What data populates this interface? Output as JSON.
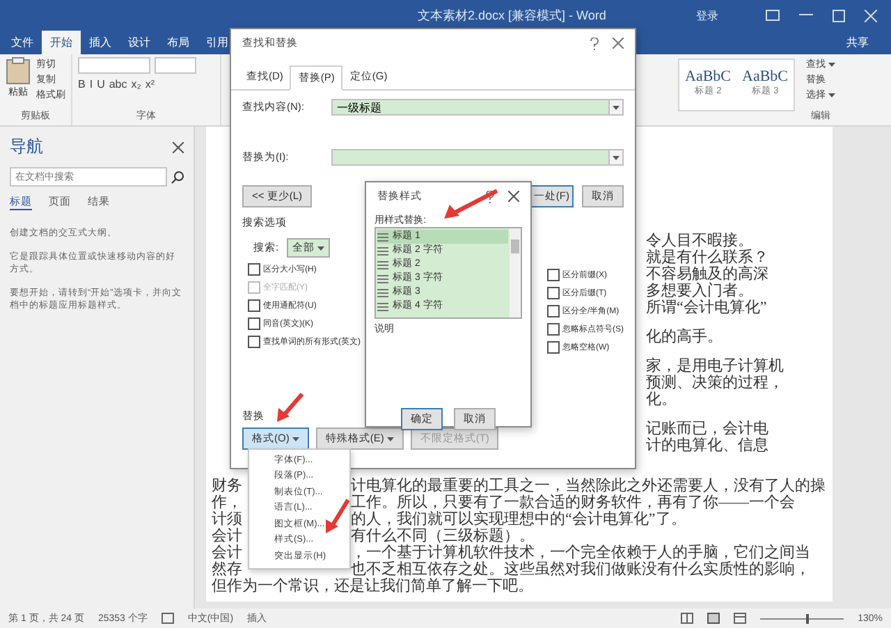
{
  "window": {
    "title": "文本素材2.docx [兼容模式] - Word",
    "account": "登录"
  },
  "ribbon_tabs": [
    {
      "label": "文件",
      "selected": false
    },
    {
      "label": "开始",
      "selected": true
    },
    {
      "label": "插入",
      "selected": false
    },
    {
      "label": "设计",
      "selected": false
    },
    {
      "label": "布局",
      "selected": false
    },
    {
      "label": "引用",
      "selected": false
    }
  ],
  "share_button": "共享",
  "clipboard": {
    "paste": "粘贴",
    "cut": "剪切",
    "copy": "复制",
    "format_painter": "格式刷",
    "label": "剪贴板"
  },
  "font_group": {
    "buttons": [
      "B",
      "I",
      "U",
      "abc",
      "x₂",
      "x²"
    ],
    "label": "字体"
  },
  "styles": [
    {
      "preview": "AaBbC",
      "name": "标题 2"
    },
    {
      "preview": "AaBbC",
      "name": "标题 3"
    }
  ],
  "editing": {
    "items": [
      {
        "label": "查找",
        "has_menu": true
      },
      {
        "label": "替换",
        "has_menu": false
      },
      {
        "label": "选择",
        "has_menu": true
      }
    ],
    "label": "编辑"
  },
  "nav": {
    "title": "导航",
    "search_placeholder": "在文档中搜索",
    "tabs": [
      {
        "label": "标题",
        "selected": true
      },
      {
        "label": "页面",
        "selected": false
      },
      {
        "label": "结果",
        "selected": false
      }
    ],
    "paragraphs": [
      "创建文档的交互式大纲。",
      "它是跟踪具体位置或快速移动内容的好方式。",
      "要想开始，请转到“开始”选项卡，并向文档中的标题应用标题样式。"
    ]
  },
  "find_dialog": {
    "title": "查找和替换",
    "tabs": [
      {
        "label": "查找(D)",
        "selected": false
      },
      {
        "label": "替换(P)",
        "selected": true
      },
      {
        "label": "定位(G)",
        "selected": false
      }
    ],
    "find_label": "查找内容(N):",
    "find_value": "一级标题",
    "replace_label": "替换为(I):",
    "less_button": "<< 更少(L)",
    "next_button": "一处(F)",
    "cancel_button": "取消",
    "options_title": "搜索选项",
    "search_label": "搜索:",
    "search_value": "全部",
    "left_options": [
      {
        "label": "区分大小写(H)",
        "checked": false,
        "disabled": false
      },
      {
        "label": "全字匹配(Y)",
        "checked": false,
        "disabled": true
      },
      {
        "label": "使用通配符(U)",
        "checked": false,
        "disabled": false
      },
      {
        "label": "同音(英文)(K)",
        "checked": false,
        "disabled": false
      },
      {
        "label": "查找单词的所有形式(英文)",
        "checked": false,
        "disabled": false
      }
    ],
    "right_options": [
      {
        "label": "区分前缀(X)",
        "checked": false,
        "disabled": false
      },
      {
        "label": "区分后缀(T)",
        "checked": false,
        "disabled": false
      },
      {
        "label": "区分全/半角(M)",
        "checked": false,
        "disabled": false
      },
      {
        "label": "忽略标点符号(S)",
        "checked": false,
        "disabled": false
      },
      {
        "label": "忽略空格(W)",
        "checked": false,
        "disabled": false
      }
    ],
    "replace_section": "替换",
    "format_buttons": [
      {
        "label": "格式(O)",
        "pressed": true,
        "disabled": false,
        "has_menu": true
      },
      {
        "label": "特殊格式(E)",
        "pressed": false,
        "disabled": false,
        "has_menu": true
      },
      {
        "label": "不限定格式(T)",
        "pressed": false,
        "disabled": true,
        "has_menu": false
      }
    ]
  },
  "style_dialog": {
    "title": "替换样式",
    "list_label": "用样式替换:",
    "styles": [
      {
        "name": "标题 1",
        "selected": true
      },
      {
        "name": "标题 2 字符",
        "selected": false
      },
      {
        "name": "标题 2",
        "selected": false
      },
      {
        "name": "标题 3 字符",
        "selected": false
      },
      {
        "name": "标题 3",
        "selected": false
      },
      {
        "name": "标题 4 字符",
        "selected": false
      }
    ],
    "description_label": "说明",
    "ok_button": "确定",
    "cancel_button": "取消"
  },
  "format_menu": [
    "字体(F)...",
    "段落(P)...",
    "制表位(T)...",
    "语言(L)...",
    "图文框(M)...",
    "样式(S)...",
    "突出显示(H)"
  ],
  "document": {
    "upper_paragraphs": [
      [
        "令人目不暇接。",
        "就是有什么联系？",
        "不容易触及的高深",
        "多想要入门者。",
        "所谓“会计电算化”"
      ],
      [
        "化的高手。"
      ],
      [
        "家，是用电子计算机",
        "预测、决策的过程，",
        "化。"
      ],
      [
        "记账而已，会计电",
        "计的电算化、信息"
      ]
    ],
    "lower_lines": [
      {
        "left": "财务",
        "right": "计电算化的最重要的工具之一，当然除此之外还需要人，没有了人的操"
      },
      {
        "left": "作，",
        "right": "工作。所以，只要有了一款合适的财务软件，再有了你——一个会"
      },
      {
        "left": "计须",
        "right": "的人，我们就可以实现理想中的“会计电算化”了。"
      },
      {
        "left": "会计",
        "right": "有什么不同（三级标题）。"
      },
      {
        "left": "会计",
        "right": "，一个基于计算机软件技术，一个完全依赖于人的手脑，它们之间当"
      },
      {
        "left": "然存",
        "right": "也不乏相互依存之处。这些虽然对我们做账没有什么实质性的影响，"
      },
      {
        "left": "但作为一个常识，还是让我们简单了解一下吧。"
      }
    ]
  },
  "status_bar": {
    "page": "第 1 页，共 24 页",
    "words": "25353 个字",
    "language": "中文(中国)",
    "mode": "插入",
    "zoom_slider": {
      "level": 0.55
    },
    "zoom": "130%"
  }
}
